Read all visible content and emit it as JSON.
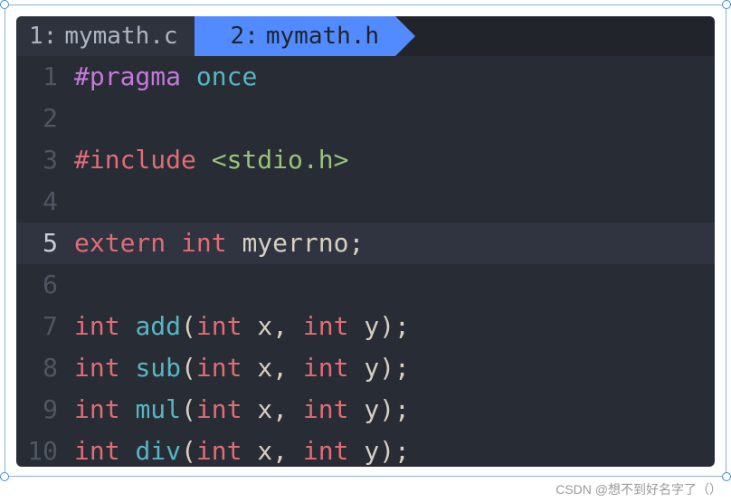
{
  "tabs": [
    {
      "num": "1:",
      "name": "mymath.c",
      "active": false
    },
    {
      "num": "2:",
      "name": "mymath.h",
      "active": true
    }
  ],
  "code": {
    "l1": {
      "pragma": "#pragma",
      "once": "once"
    },
    "l3": {
      "include": "#include",
      "header": "<stdio.h>"
    },
    "l5": {
      "extern": "extern",
      "int": "int",
      "id": "myerrno",
      "semi": ";"
    },
    "fn": {
      "int": "int",
      "open": "(",
      "close": ")",
      "comma": ",",
      "semi": ";",
      "px": "x",
      "py": "y",
      "add": "add",
      "sub": "sub",
      "mul": "mul",
      "div": "div"
    }
  },
  "lineNumbers": [
    "1",
    "2",
    "3",
    "4",
    "5",
    "6",
    "7",
    "8",
    "9",
    "10"
  ],
  "currentLine": 5,
  "watermark": "CSDN @想不到好名字了（）"
}
